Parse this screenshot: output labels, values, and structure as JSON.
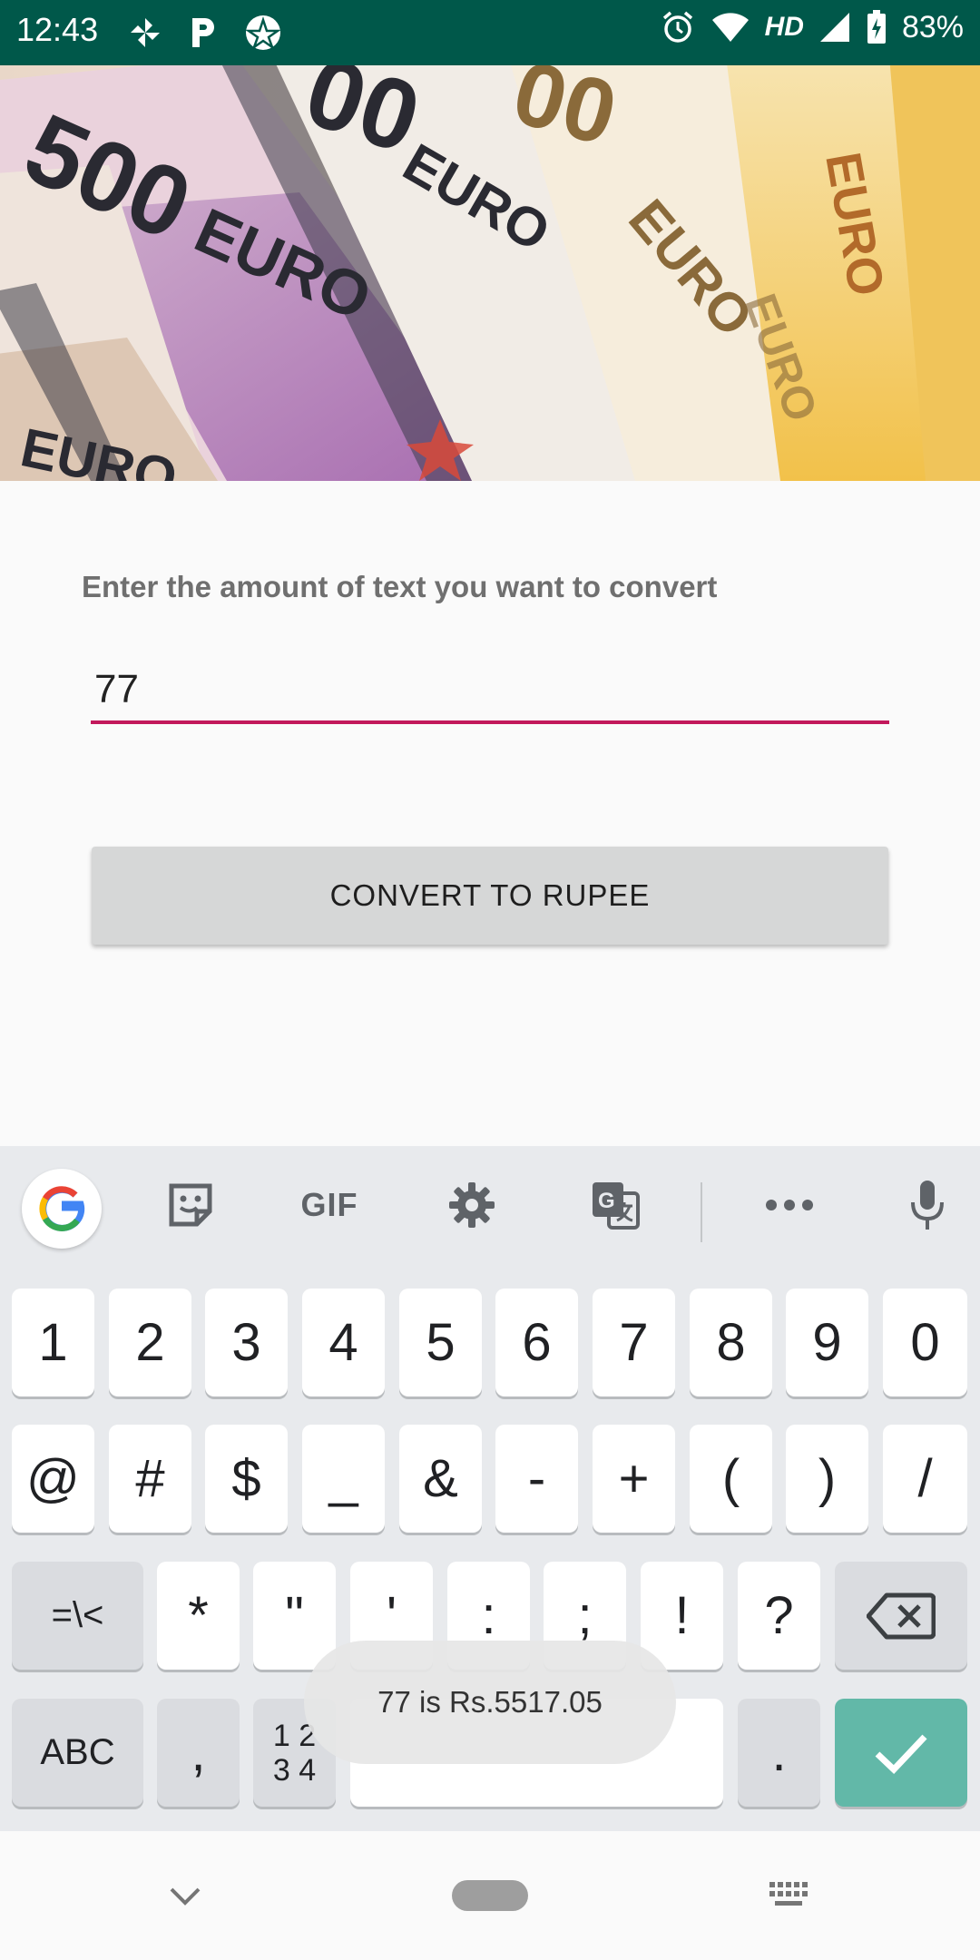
{
  "status_bar": {
    "time": "12:43",
    "network": "HD",
    "battery": "83%",
    "icons": [
      "pinwheel-icon",
      "parking-icon",
      "star-circle-icon",
      "alarm-icon",
      "wifi-icon",
      "signal-icon",
      "battery-charging-icon"
    ]
  },
  "hero": {
    "image": "euro-banknotes",
    "notes": [
      "500",
      "EURO",
      "00",
      "EURO",
      "00",
      "EURO",
      "EURO",
      "EURO",
      "EURO"
    ]
  },
  "form": {
    "label": "Enter the amount of text you want to convert",
    "input_value": "77",
    "accent_color": "#c2185b"
  },
  "button": {
    "label": "CONVERT TO RUPEE"
  },
  "toast": {
    "message": "77 is Rs.5517.05"
  },
  "keyboard": {
    "toolbar": [
      "google-icon",
      "sticker-icon",
      "GIF",
      "settings-icon",
      "translate-icon",
      "more-icon",
      "mic-icon"
    ],
    "gif_label": "GIF",
    "row1": [
      "1",
      "2",
      "3",
      "4",
      "5",
      "6",
      "7",
      "8",
      "9",
      "0"
    ],
    "row2": [
      "@",
      "#",
      "$",
      "_",
      "&",
      "-",
      "+",
      "(",
      ")",
      "/"
    ],
    "row3": {
      "symbols_key": "=\\<",
      "keys": [
        "*",
        "\"",
        "'",
        ":",
        ";",
        "!",
        "?"
      ],
      "backspace": "backspace-icon"
    },
    "row4": {
      "abc": "ABC",
      "comma": ",",
      "numpad_top": "1 2",
      "numpad_bottom": "3 4",
      "period": ".",
      "enter": "check-icon"
    },
    "enter_color": "#62b8a8"
  },
  "nav_bar": {
    "icons": [
      "chevron-down-icon",
      "home-pill",
      "keyboard-icon"
    ]
  }
}
